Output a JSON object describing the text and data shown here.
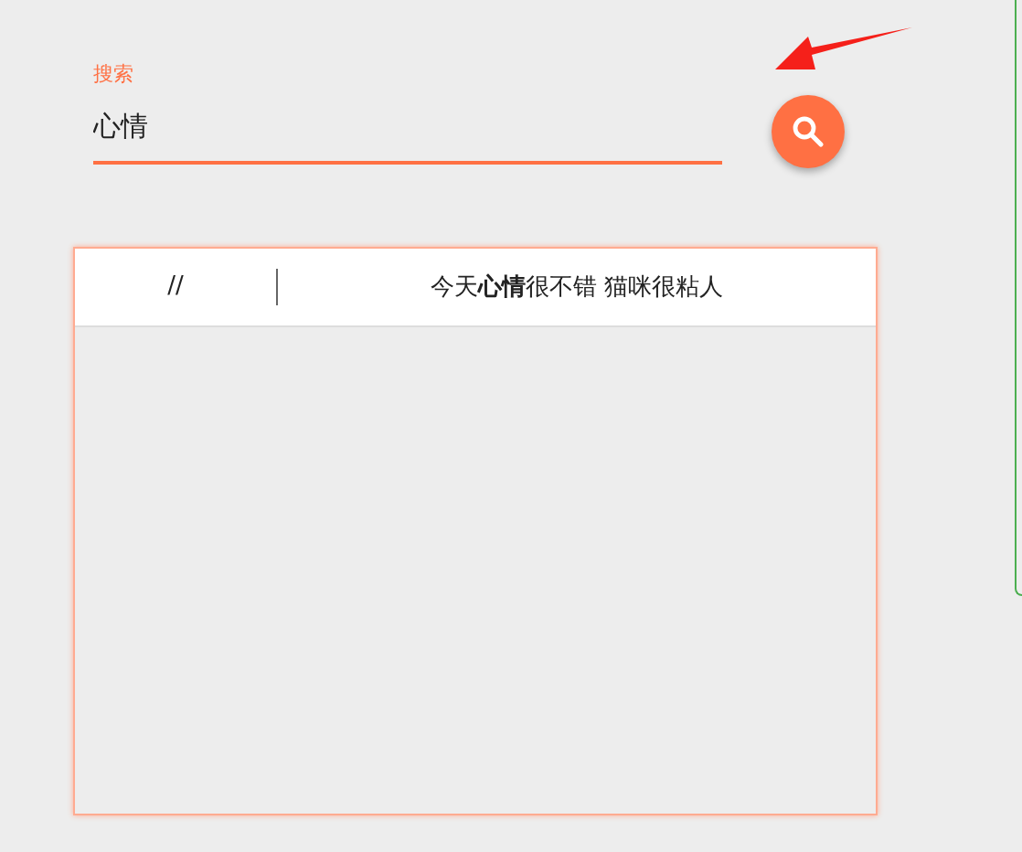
{
  "search": {
    "label": "搜索",
    "value": "心情"
  },
  "results": [
    {
      "column_1": "//",
      "column_2": "今天**心情**很不错 猫咪很粘人"
    }
  ]
}
